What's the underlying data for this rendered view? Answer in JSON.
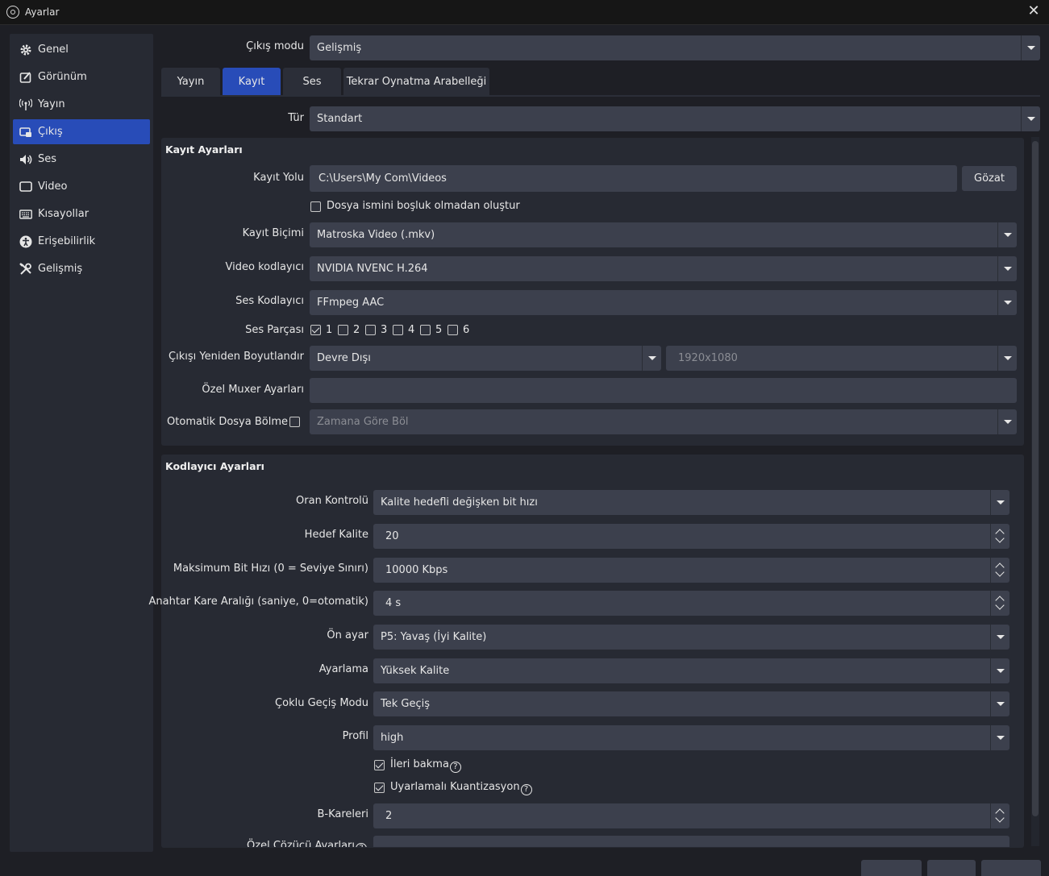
{
  "window": {
    "title": "Ayarlar"
  },
  "sidebar": {
    "items": [
      {
        "label": "Genel",
        "icon": "gear-icon"
      },
      {
        "label": "Görünüm",
        "icon": "appearance-icon"
      },
      {
        "label": "Yayın",
        "icon": "broadcast-icon"
      },
      {
        "label": "Çıkış",
        "icon": "output-icon"
      },
      {
        "label": "Ses",
        "icon": "speaker-icon"
      },
      {
        "label": "Video",
        "icon": "monitor-icon"
      },
      {
        "label": "Kısayollar",
        "icon": "keyboard-icon"
      },
      {
        "label": "Erişebilirlik",
        "icon": "accessibility-icon"
      },
      {
        "label": "Gelişmiş",
        "icon": "tools-icon"
      }
    ],
    "active": "Çıkış"
  },
  "output_mode": {
    "label": "Çıkış modu",
    "value": "Gelişmiş"
  },
  "tabs": [
    "Yayın",
    "Kayıt",
    "Ses",
    "Tekrar Oynatma Arabelleği"
  ],
  "active_tab": "Kayıt",
  "type": {
    "label": "Tür",
    "value": "Standart"
  },
  "recording": {
    "title": "Kayıt Ayarları",
    "path_label": "Kayıt Yolu",
    "path_value": "C:\\Users\\My Com\\Videos",
    "browse_label": "Gözat",
    "no_space_label": "Dosya ismini boşluk olmadan oluştur",
    "format_label": "Kayıt Biçimi",
    "format_value": "Matroska Video (.mkv)",
    "video_encoder_label": "Video kodlayıcı",
    "video_encoder_value": "NVIDIA NVENC H.264",
    "audio_encoder_label": "Ses Kodlayıcı",
    "audio_encoder_value": "FFmpeg AAC",
    "audio_track_label": "Ses Parçası",
    "tracks": [
      "1",
      "2",
      "3",
      "4",
      "5",
      "6"
    ],
    "tracks_checked": [
      true,
      false,
      false,
      false,
      false,
      false
    ],
    "rescale_label": "Çıkışı Yeniden Boyutlandır",
    "rescale_value": "Devre Dışı",
    "rescale_resolution": "1920x1080",
    "muxer_label": "Özel Muxer Ayarları",
    "muxer_value": "",
    "split_label": "Otomatik Dosya Bölme",
    "split_value": "Zamana Göre Böl"
  },
  "encoder": {
    "title": "Kodlayıcı Ayarları",
    "rate_control_label": "Oran Kontrolü",
    "rate_control_value": "Kalite hedefli değişken bit hızı",
    "target_quality_label": "Hedef Kalite",
    "target_quality_value": "20",
    "max_bitrate_label": "Maksimum Bit Hızı (0 = Seviye Sınırı)",
    "max_bitrate_value": "10000 Kbps",
    "keyframe_label": "Anahtar Kare Aralığı (saniye, 0=otomatik)",
    "keyframe_value": "4 s",
    "preset_label": "Ön ayar",
    "preset_value": "P5: Yavaş (İyi Kalite)",
    "tuning_label": "Ayarlama",
    "tuning_value": "Yüksek Kalite",
    "multipass_label": "Çoklu Geçiş Modu",
    "multipass_value": "Tek Geçiş",
    "profile_label": "Profil",
    "profile_value": "high",
    "lookahead_label": "İleri bakma",
    "aq_label": "Uyarlamalı Kuantizasyon",
    "bframes_label": "B-Kareleri",
    "bframes_value": "2",
    "custom_label": "Özel Çözücü Ayarları"
  },
  "colors": {
    "accent": "#284cb8",
    "panel": "#272a33",
    "field": "#3c404d",
    "background": "#1e1f25"
  }
}
